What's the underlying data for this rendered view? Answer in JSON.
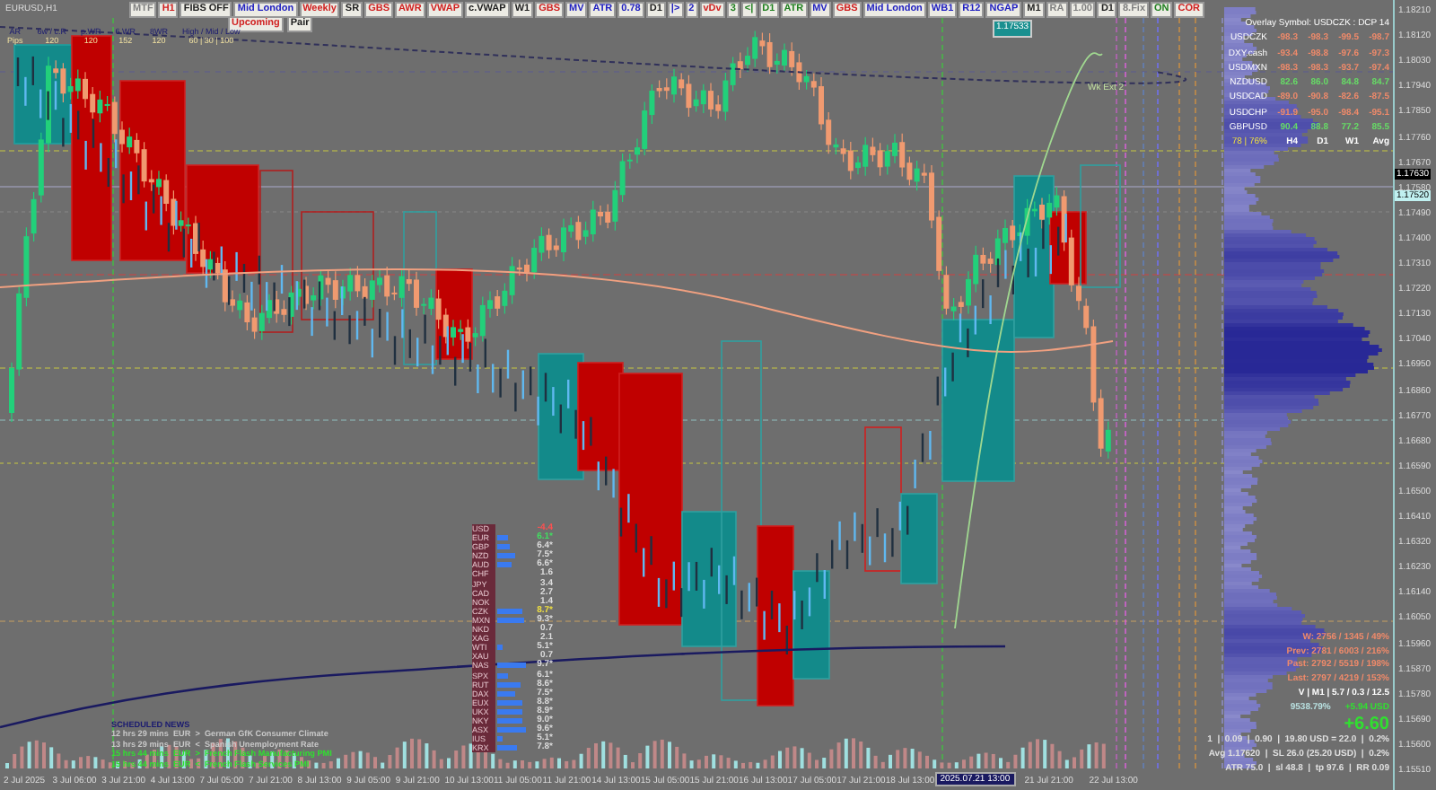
{
  "symbol": "EURUSD,H1",
  "toolbar": [
    {
      "label": "MTF",
      "color": "#808080"
    },
    {
      "label": "H1",
      "color": "#d02020"
    },
    {
      "label": "FIBS OFF",
      "color": "#202020"
    },
    {
      "label": "Mid London",
      "color": "#2020c0"
    },
    {
      "label": "Weekly",
      "color": "#d02020"
    },
    {
      "label": "SR",
      "color": "#202020"
    },
    {
      "label": "GBS",
      "color": "#d02020"
    },
    {
      "label": "AWR",
      "color": "#d02020"
    },
    {
      "label": "VWAP",
      "color": "#d02020"
    },
    {
      "label": "c.VWAP",
      "color": "#202020"
    },
    {
      "label": "W1",
      "color": "#202020"
    },
    {
      "label": "GBS",
      "color": "#d02020"
    },
    {
      "label": "MV",
      "color": "#2020c0"
    },
    {
      "label": "ATR",
      "color": "#2020c0"
    },
    {
      "label": "0.78",
      "color": "#2020c0"
    },
    {
      "label": "D1",
      "color": "#202020"
    },
    {
      "label": "|>",
      "color": "#2020c0"
    },
    {
      "label": "2",
      "color": "#2020c0"
    },
    {
      "label": "vDv",
      "color": "#d02020"
    },
    {
      "label": "3",
      "color": "#208020"
    },
    {
      "label": "<|",
      "color": "#208020"
    },
    {
      "label": "D1",
      "color": "#208020"
    },
    {
      "label": "ATR",
      "color": "#208020"
    },
    {
      "label": "MV",
      "color": "#2020c0"
    },
    {
      "label": "GBS",
      "color": "#d02020"
    },
    {
      "label": "Mid London",
      "color": "#2020c0"
    },
    {
      "label": "WB1",
      "color": "#2020c0"
    },
    {
      "label": "R12",
      "color": "#2020c0"
    },
    {
      "label": "NGAP",
      "color": "#2020c0"
    },
    {
      "label": "M1",
      "color": "#202020"
    },
    {
      "label": "RA",
      "color": "#808080"
    },
    {
      "label": "1.00",
      "color": "#808080"
    },
    {
      "label": "D1",
      "color": "#202020"
    },
    {
      "label": "8.Fix",
      "color": "#808080"
    },
    {
      "label": "ON",
      "color": "#208020"
    },
    {
      "label": "COR",
      "color": "#d02020"
    }
  ],
  "toolbar_row2": [
    {
      "label": "Upcoming",
      "color": "#d02020"
    },
    {
      "label": "Pair",
      "color": "#202020"
    }
  ],
  "range_stats": [
    {
      "label": "AR",
      "value": "Pips"
    },
    {
      "label": "6w / c.R",
      "value": "120"
    },
    {
      "label": "p.WR",
      "value": "120"
    },
    {
      "label": "6.WR",
      "value": "152"
    },
    {
      "label": "8WR",
      "value": "120"
    },
    {
      "label": "High / Mid / Low",
      "value": "60 | 30 | 100"
    }
  ],
  "chart_labels": [
    {
      "text": "1.17533",
      "kind": "price"
    },
    {
      "text": "Wk Ext 2",
      "kind": "note"
    }
  ],
  "overlay": {
    "title": "Overlay Symbol: USDCZK : DCP 14",
    "rows": [
      {
        "symbol": "USDCZK",
        "values": [
          "-98.3",
          "-98.3",
          "-99.5",
          "-98.7"
        ],
        "color": "#f08a6a"
      },
      {
        "symbol": "DXY.cash",
        "values": [
          "-93.4",
          "-98.8",
          "-97.6",
          "-97.3"
        ],
        "color": "#f08a6a"
      },
      {
        "symbol": "USDMXN",
        "values": [
          "-98.3",
          "-98.3",
          "-93.7",
          "-97.4"
        ],
        "color": "#f08a6a"
      },
      {
        "symbol": "NZDUSD",
        "values": [
          "82.6",
          "86.0",
          "84.8",
          "84.7"
        ],
        "color": "#66dd66"
      },
      {
        "symbol": "USDCAD",
        "values": [
          "-89.0",
          "-90.8",
          "-82.6",
          "-87.5"
        ],
        "color": "#f08a6a"
      },
      {
        "symbol": "USDCHP",
        "values": [
          "-91.9",
          "-95.0",
          "-98.4",
          "-95.1"
        ],
        "color": "#f08a6a"
      },
      {
        "symbol": "GBPUSD",
        "values": [
          "90.4",
          "88.8",
          "77.2",
          "85.5"
        ],
        "color": "#66dd66"
      }
    ],
    "footer": [
      "78 | 76%",
      "H4",
      "D1",
      "W1",
      "Avg"
    ]
  },
  "price_axis": [
    "1.18210",
    "1.18120",
    "1.18030",
    "1.17940",
    "1.17850",
    "1.17760",
    "1.17670",
    "1.17580",
    "1.17490",
    "1.17400",
    "1.17310",
    "1.17220",
    "1.17130",
    "1.17040",
    "1.16950",
    "1.16860",
    "1.16770",
    "1.16680",
    "1.16590",
    "1.16500",
    "1.16410",
    "1.16320",
    "1.16230",
    "1.16140",
    "1.16050",
    "1.15960",
    "1.15870",
    "1.15780",
    "1.15690",
    "1.15600",
    "1.15510"
  ],
  "price_markers": [
    {
      "label": "1.17630",
      "kind": "bid"
    },
    {
      "label": "1.17520",
      "kind": "ask"
    }
  ],
  "time_axis": [
    {
      "label": "2 Jul 2025",
      "kind": "tick"
    },
    {
      "label": "3 Jul 06:00",
      "kind": "tick"
    },
    {
      "label": "3 Jul 21:00",
      "kind": "tick"
    },
    {
      "label": "4 Jul 13:00",
      "kind": "tick"
    },
    {
      "label": "7 Jul 05:00",
      "kind": "tick"
    },
    {
      "label": "7 Jul 21:00",
      "kind": "tick"
    },
    {
      "label": "8 Jul 13:00",
      "kind": "tick"
    },
    {
      "label": "9 Jul 05:00",
      "kind": "tick"
    },
    {
      "label": "9 Jul 21:00",
      "kind": "tick"
    },
    {
      "label": "10 Jul 13:00",
      "kind": "tick"
    },
    {
      "label": "11 Jul 05:00",
      "kind": "tick"
    },
    {
      "label": "11 Jul 21:00",
      "kind": "tick"
    },
    {
      "label": "14 Jul 13:00",
      "kind": "tick"
    },
    {
      "label": "15 Jul 05:00",
      "kind": "tick"
    },
    {
      "label": "15 Jul 21:00",
      "kind": "tick"
    },
    {
      "label": "16 Jul 13:00",
      "kind": "tick"
    },
    {
      "label": "17 Jul 05:00",
      "kind": "tick"
    },
    {
      "label": "17 Jul 21:00",
      "kind": "tick"
    },
    {
      "label": "18 Jul 13:00",
      "kind": "tick"
    },
    {
      "label": "2025.07.21 13:00",
      "kind": "cursor"
    },
    {
      "label": "21 Jul 21:00",
      "kind": "tick"
    },
    {
      "label": "22 Jul 13:00",
      "kind": "tick"
    }
  ],
  "strength": [
    {
      "code": "USD",
      "value": "-4.4",
      "color": "#ff5050"
    },
    {
      "code": "EUR",
      "value": "6.1*",
      "color": "#40e060"
    },
    {
      "code": "GBP",
      "value": "6.4*",
      "color": "#dddddd"
    },
    {
      "code": "NZD",
      "value": "7.5*",
      "color": "#dddddd"
    },
    {
      "code": "AUD",
      "value": "6.6*",
      "color": "#dddddd"
    },
    {
      "code": "CHF",
      "value": "1.6",
      "color": "#dddddd"
    },
    {
      "code": "JPY",
      "value": "3.4",
      "color": "#dddddd"
    },
    {
      "code": "CAD",
      "value": "2.7",
      "color": "#dddddd"
    },
    {
      "code": "NOK",
      "value": "1.4",
      "color": "#dddddd"
    },
    {
      "code": "CZK",
      "value": "8.7*",
      "color": "#f0e040"
    },
    {
      "code": "MXN",
      "value": "9.3*",
      "color": "#dddddd"
    },
    {
      "code": "NKD",
      "value": "0.7",
      "color": "#dddddd"
    },
    {
      "code": "XAG",
      "value": "2.1",
      "color": "#dddddd"
    },
    {
      "code": "WTI",
      "value": "5.1*",
      "color": "#dddddd"
    },
    {
      "code": "XAU",
      "value": "0.7",
      "color": "#dddddd"
    },
    {
      "code": "NAS",
      "value": "9.7*",
      "color": "#dddddd"
    },
    {
      "code": "SPX",
      "value": "6.1*",
      "color": "#dddddd"
    },
    {
      "code": "RUT",
      "value": "8.6*",
      "color": "#dddddd"
    },
    {
      "code": "DAX",
      "value": "7.5*",
      "color": "#dddddd"
    },
    {
      "code": "EUX",
      "value": "8.8*",
      "color": "#dddddd"
    },
    {
      "code": "UKX",
      "value": "8.9*",
      "color": "#dddddd"
    },
    {
      "code": "NKY",
      "value": "9.0*",
      "color": "#dddddd"
    },
    {
      "code": "ASX",
      "value": "9.6*",
      "color": "#dddddd"
    },
    {
      "code": "IUS",
      "value": "5.1*",
      "color": "#dddddd"
    },
    {
      "code": "KRX",
      "value": "7.8*",
      "color": "#dddddd"
    }
  ],
  "news": {
    "title": "SCHEDULED NEWS",
    "items": [
      {
        "text": "12 hrs 29 mins  EUR  >  German GfK Consumer Climate",
        "color": "#c8c8c8"
      },
      {
        "text": "13 hrs 29 mins  EUR  <  Spanish Unemployment Rate",
        "color": "#c8c8c8"
      },
      {
        "text": "15 hrs 44 mins  EUR  >  French Flash Manufacturing PMI",
        "color": "#30e030"
      },
      {
        "text": "15 hrs 44 mins  EUR  <  French Flash Services PMI",
        "color": "#30e030"
      }
    ]
  },
  "account": [
    [
      {
        "text": "W: 2756 / 1345 / 49%",
        "color": "#f08a6a",
        "kind": "normal"
      }
    ],
    [
      {
        "text": "Prev: 2781 / 6003 / 216%",
        "color": "#f08a6a",
        "kind": "normal"
      }
    ],
    [
      {
        "text": "Past: 2792 / 5519 / 198%",
        "color": "#f08a6a",
        "kind": "normal"
      }
    ],
    [
      {
        "text": "Last: 2797 / 4219 / 153%",
        "color": "#f08a6a",
        "kind": "normal"
      }
    ],
    [
      {
        "text": "V | M1 | 5.7 / 0.3 / 12.5",
        "color": "#ffffff",
        "kind": "normal"
      }
    ],
    [
      {
        "text": "9538.79%",
        "color": "#b8e0e0",
        "kind": "normal"
      },
      {
        "text": "+5.94 USD",
        "color": "#30e030",
        "kind": "normal"
      }
    ],
    [
      {
        "text": "+6.60",
        "color": "#30e030",
        "kind": "big"
      }
    ],
    [
      {
        "text": "1  |  0.09  |  0.90  |  19.80 USD = 22.0  |  0.2%",
        "color": "#e0e0e0",
        "kind": "normal"
      }
    ],
    [
      {
        "text": "Avg 1.17620  |  SL 26.0 (25.20 USD)  |  0.2%",
        "color": "#e0e0e0",
        "kind": "normal"
      }
    ],
    [
      {
        "text": "ATR 75.0  |  sl 48.8  |  tp 97.6  |  RR 0.09",
        "color": "#e0e0e0",
        "kind": "normal"
      }
    ]
  ]
}
